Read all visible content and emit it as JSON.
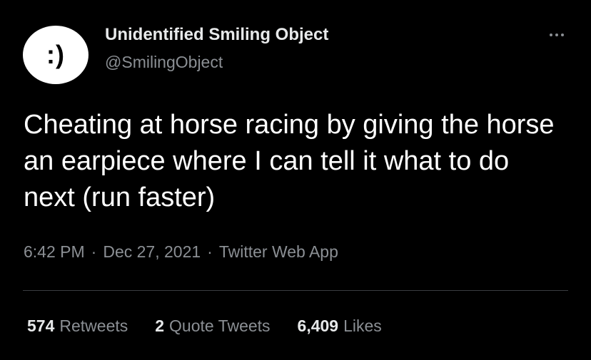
{
  "author": {
    "display_name": "Unidentified Smiling Object",
    "handle": "@SmilingObject",
    "avatar_text": ":)"
  },
  "tweet": {
    "text": "Cheating at horse racing by giving the horse an earpiece where I can tell it what to do next (run faster)",
    "time": "6:42 PM",
    "separator": "·",
    "date": "Dec 27, 2021",
    "source": "Twitter Web App"
  },
  "stats": {
    "retweets": {
      "count": "574",
      "label": "Retweets"
    },
    "quote_tweets": {
      "count": "2",
      "label": "Quote Tweets"
    },
    "likes": {
      "count": "6,409",
      "label": "Likes"
    }
  },
  "icons": {
    "more": "more-options-icon"
  },
  "colors": {
    "background": "#000000",
    "primary_text": "#e7e9ea",
    "secondary_text": "#8b8f94",
    "divider": "#3a3d40",
    "avatar_bg": "#ffffff"
  }
}
